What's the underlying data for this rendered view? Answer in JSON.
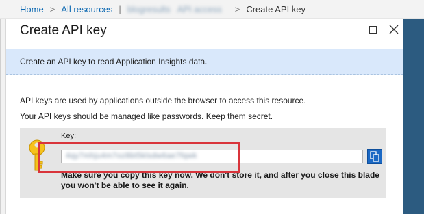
{
  "breadcrumb": {
    "items": [
      "Home",
      "All resources",
      "blogresults",
      "API access"
    ],
    "current": "Create API key",
    "separator": ">"
  },
  "blade": {
    "title": "Create API key",
    "maximize_icon": "maximize-icon",
    "close_icon": "close-icon"
  },
  "info_bar": {
    "text": "Create an API key to read Application Insights data."
  },
  "description": {
    "line1": "API keys are used by applications outside the browser to access this resource.",
    "line2": "Your API keys should be managed like passwords. Keep them secret."
  },
  "key_panel": {
    "icon": "key-icon",
    "label": "Key:",
    "value": "4qy7mhju4m7oz8bt5klsdw6ae7fqwk",
    "copy_icon": "copy-icon",
    "warning": "Make sure you copy this key now. We don't store it, and after you close this blade you won't be able to see it again."
  },
  "colors": {
    "accent": "#1a68c4",
    "info_background": "#d9e8fb",
    "highlight": "#d9343b",
    "side_band": "#2c5b80"
  }
}
